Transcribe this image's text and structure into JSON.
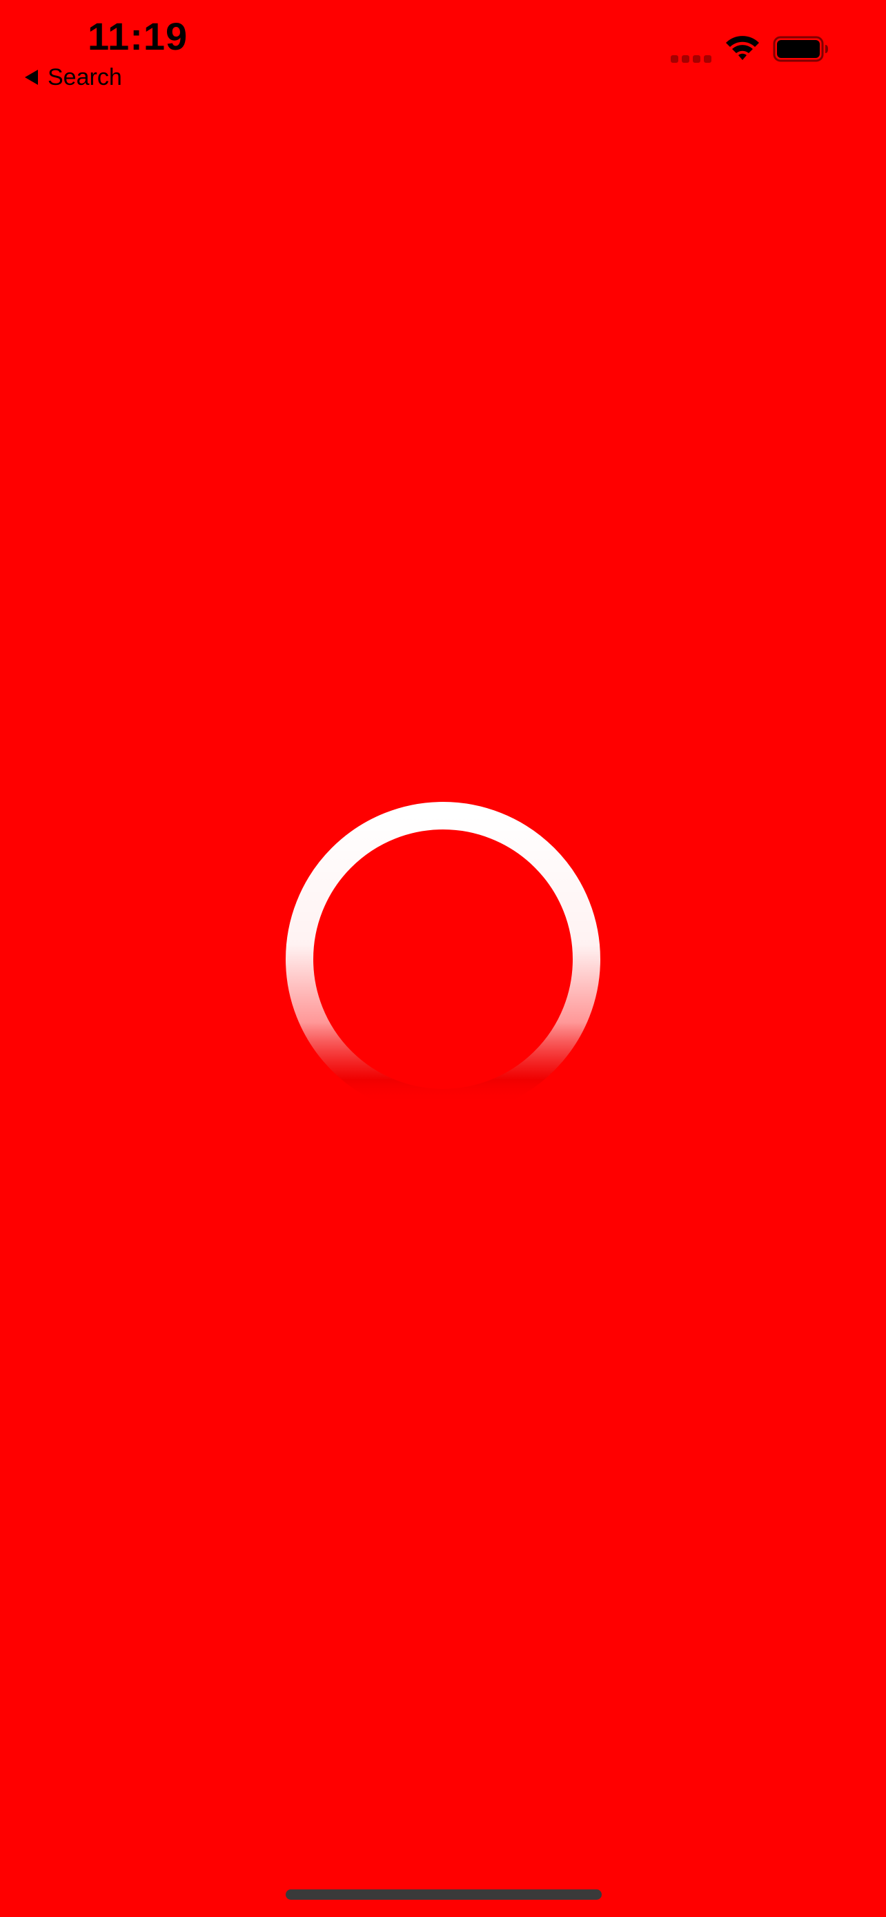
{
  "status_bar": {
    "time": "11:19",
    "back_label": "Search",
    "wifi_icon": "wifi-icon",
    "battery_icon": "battery-icon",
    "signal_icon": "cellular-signal-icon"
  },
  "screen": {
    "background_color": "#ff0000",
    "loader_icon": "loading-spinner-icon",
    "loader_color": "#ffffff"
  }
}
